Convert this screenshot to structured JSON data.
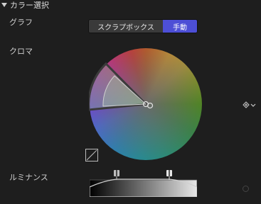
{
  "section": {
    "title": "カラー選択"
  },
  "rows": {
    "graph_label": "グラフ",
    "chroma_label": "クロマ",
    "luminance_label": "ルミナンス"
  },
  "mode_switch": {
    "options": [
      "スクラプボックス",
      "手動"
    ],
    "selected": "手動"
  },
  "icons": {
    "section_toggle": "disclosure-triangle-icon",
    "keyframe": "keyframe-diamond-icon",
    "keyframe_menu": "chevron-down-icon",
    "invert": "diagonal-square-icon",
    "reset": "circle-icon"
  },
  "colors": {
    "background": "#1e1e1e",
    "accent": "#4d4fd6",
    "selection_sector": "#8fbf8f"
  }
}
